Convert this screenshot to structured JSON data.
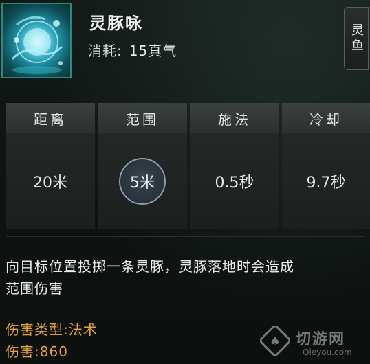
{
  "skill": {
    "name": "灵豚咏",
    "cost_label": "消耗:",
    "cost_value": "15真气",
    "type_tag": "灵鱼",
    "icon": "water-dolphin-icon"
  },
  "stats": {
    "distance": {
      "label": "距离",
      "value": "20米"
    },
    "range": {
      "label": "范围",
      "value": "5米"
    },
    "cast": {
      "label": "施法",
      "value": "0.5秒"
    },
    "cooldown": {
      "label": "冷却",
      "value": "9.7秒"
    }
  },
  "description": {
    "line1": "向目标位置投掷一条灵豚，灵豚落地时会造成",
    "line2": "范围伤害"
  },
  "attributes": {
    "damage_type_label": "伤害类型:",
    "damage_type_value": "法术",
    "damage_label": "伤害:",
    "damage_value": "860"
  },
  "watermark": {
    "text": "切游网",
    "sub": "Qieyou.com"
  },
  "colors": {
    "accent_gold": "#e5a23b",
    "icon_border": "#2b8a7f"
  }
}
